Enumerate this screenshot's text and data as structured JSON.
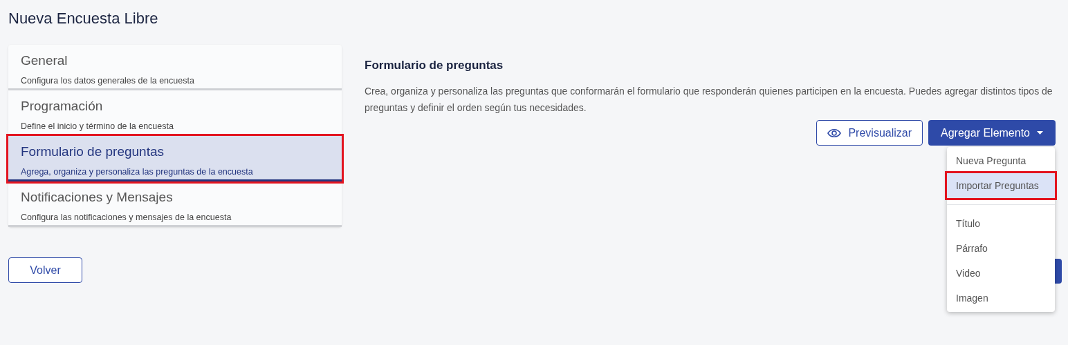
{
  "page_title": "Nueva Encuesta Libre",
  "steps": [
    {
      "title": "General",
      "description": "Configura los datos generales de la encuesta",
      "selected": false,
      "outlined": false
    },
    {
      "title": "Programación",
      "description": "Define el inicio y término de la encuesta",
      "selected": false,
      "outlined": false
    },
    {
      "title": "Formulario de preguntas",
      "description": "Agrega, organiza y personaliza las preguntas de la encuesta",
      "selected": true,
      "outlined": true
    },
    {
      "title": "Notificaciones y Mensajes",
      "description": "Configura las notificaciones y mensajes de la encuesta",
      "selected": false,
      "outlined": false
    }
  ],
  "back_button": "Volver",
  "section": {
    "title": "Formulario de preguntas",
    "description": "Crea, organiza y personaliza las preguntas que conformarán el formulario que responderán quienes participen en la encuesta. Puedes agregar distintos tipos de preguntas y definir el orden según tus necesidades."
  },
  "preview_button": "Previsualizar",
  "add_button": "Agregar Elemento",
  "menu": {
    "groups": [
      [
        {
          "label": "Nueva Pregunta",
          "selected": false,
          "outlined": false
        },
        {
          "label": "Importar Preguntas",
          "selected": true,
          "outlined": true
        }
      ],
      [
        {
          "label": "Título",
          "selected": false,
          "outlined": false
        },
        {
          "label": "Párrafo",
          "selected": false,
          "outlined": false
        },
        {
          "label": "Video",
          "selected": false,
          "outlined": false
        },
        {
          "label": "Imagen",
          "selected": false,
          "outlined": false
        }
      ]
    ]
  }
}
